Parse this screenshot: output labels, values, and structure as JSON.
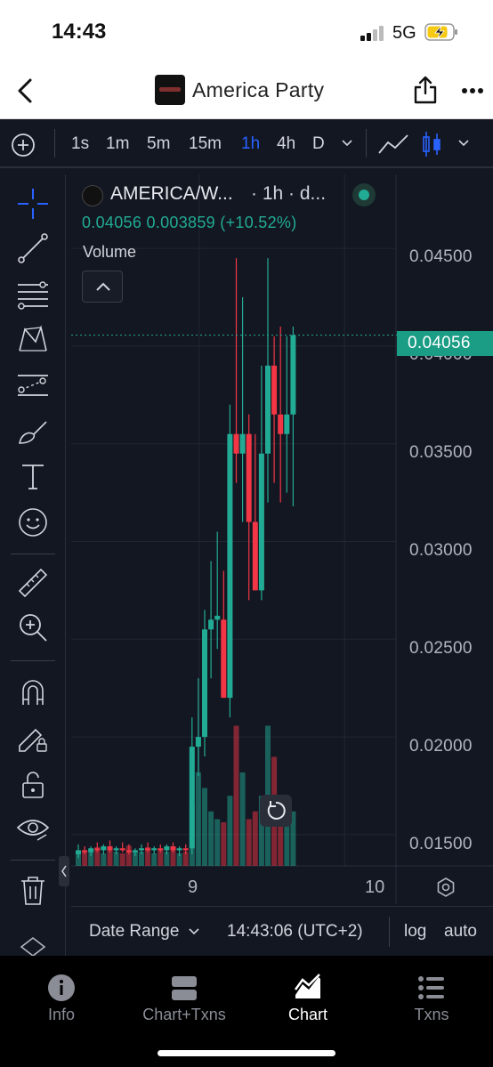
{
  "status_bar": {
    "time": "14:43",
    "network": "5G"
  },
  "header": {
    "title": "America Party"
  },
  "toolbar": {
    "timeframes": [
      "1s",
      "1m",
      "5m",
      "15m",
      "1h",
      "4h",
      "D"
    ],
    "active_timeframe": "1h"
  },
  "chart": {
    "symbol": "AMERICA/W...",
    "interval_label": "· 1h · d...",
    "last_price": "0.04056",
    "change": "0.003859",
    "change_pct": "(+10.52%)",
    "volume_label": "Volume",
    "price_ticks": [
      "0.04500",
      "0.04000",
      "0.03500",
      "0.03000",
      "0.02500",
      "0.02000",
      "0.01500"
    ],
    "time_ticks": [
      "9",
      "10"
    ],
    "footer": {
      "date_range_label": "Date Range",
      "clock": "14:43:06 (UTC+2)",
      "log_label": "log",
      "auto_label": "auto"
    }
  },
  "colors": {
    "up": "#22ab94",
    "down": "#f23645",
    "accent": "#2962ff",
    "background": "#131722"
  },
  "chart_data": {
    "type": "candlestick",
    "interval": "1h",
    "ylim": [
      0.0134,
      0.0471
    ],
    "price_tick_values": [
      0.045,
      0.04,
      0.035,
      0.03,
      0.025,
      0.02,
      0.015
    ],
    "last_price": 0.04056,
    "candles": [
      {
        "o": 0.014,
        "h": 0.0145,
        "l": 0.0138,
        "c": 0.0142
      },
      {
        "o": 0.0142,
        "h": 0.0144,
        "l": 0.014,
        "c": 0.0141
      },
      {
        "o": 0.0141,
        "h": 0.0144,
        "l": 0.0139,
        "c": 0.0143
      },
      {
        "o": 0.0143,
        "h": 0.0146,
        "l": 0.0141,
        "c": 0.0142
      },
      {
        "o": 0.0142,
        "h": 0.0145,
        "l": 0.014,
        "c": 0.0144
      },
      {
        "o": 0.0144,
        "h": 0.0147,
        "l": 0.0141,
        "c": 0.0142
      },
      {
        "o": 0.0142,
        "h": 0.0144,
        "l": 0.014,
        "c": 0.0143
      },
      {
        "o": 0.0143,
        "h": 0.0146,
        "l": 0.0141,
        "c": 0.0142
      },
      {
        "o": 0.0142,
        "h": 0.0145,
        "l": 0.014,
        "c": 0.0141
      },
      {
        "o": 0.0141,
        "h": 0.0143,
        "l": 0.0139,
        "c": 0.0142
      },
      {
        "o": 0.0142,
        "h": 0.0145,
        "l": 0.014,
        "c": 0.0143
      },
      {
        "o": 0.0143,
        "h": 0.0146,
        "l": 0.0141,
        "c": 0.0142
      },
      {
        "o": 0.0142,
        "h": 0.0144,
        "l": 0.014,
        "c": 0.0143
      },
      {
        "o": 0.0143,
        "h": 0.0145,
        "l": 0.0141,
        "c": 0.0142
      },
      {
        "o": 0.0142,
        "h": 0.0145,
        "l": 0.014,
        "c": 0.0144
      },
      {
        "o": 0.0144,
        "h": 0.0146,
        "l": 0.0141,
        "c": 0.0142
      },
      {
        "o": 0.0142,
        "h": 0.0144,
        "l": 0.0139,
        "c": 0.0143
      },
      {
        "o": 0.0143,
        "h": 0.0145,
        "l": 0.014,
        "c": 0.0142
      },
      {
        "o": 0.0143,
        "h": 0.021,
        "l": 0.014,
        "c": 0.0195
      },
      {
        "o": 0.0195,
        "h": 0.023,
        "l": 0.018,
        "c": 0.02
      },
      {
        "o": 0.02,
        "h": 0.0265,
        "l": 0.019,
        "c": 0.0255
      },
      {
        "o": 0.0255,
        "h": 0.029,
        "l": 0.023,
        "c": 0.026
      },
      {
        "o": 0.026,
        "h": 0.0305,
        "l": 0.0245,
        "c": 0.0262
      },
      {
        "o": 0.026,
        "h": 0.0285,
        "l": 0.023,
        "c": 0.022
      },
      {
        "o": 0.022,
        "h": 0.037,
        "l": 0.021,
        "c": 0.0355
      },
      {
        "o": 0.0355,
        "h": 0.0445,
        "l": 0.033,
        "c": 0.0345
      },
      {
        "o": 0.0345,
        "h": 0.0425,
        "l": 0.031,
        "c": 0.0355
      },
      {
        "o": 0.0355,
        "h": 0.0365,
        "l": 0.027,
        "c": 0.031
      },
      {
        "o": 0.031,
        "h": 0.0355,
        "l": 0.0275,
        "c": 0.0275
      },
      {
        "o": 0.0275,
        "h": 0.039,
        "l": 0.027,
        "c": 0.0345
      },
      {
        "o": 0.0345,
        "h": 0.0445,
        "l": 0.032,
        "c": 0.039
      },
      {
        "o": 0.039,
        "h": 0.0405,
        "l": 0.033,
        "c": 0.0365
      },
      {
        "o": 0.0365,
        "h": 0.041,
        "l": 0.032,
        "c": 0.0355
      },
      {
        "o": 0.0355,
        "h": 0.0405,
        "l": 0.0325,
        "c": 0.0365
      },
      {
        "o": 0.0365,
        "h": 0.041,
        "l": 0.0318,
        "c": 0.04056
      }
    ],
    "volume": [
      0.08,
      0.1,
      0.09,
      0.12,
      0.08,
      0.1,
      0.09,
      0.08,
      0.13,
      0.1,
      0.09,
      0.12,
      0.08,
      0.1,
      0.09,
      0.11,
      0.08,
      0.09,
      0.4,
      0.6,
      0.5,
      0.35,
      0.3,
      0.28,
      0.45,
      0.9,
      0.6,
      0.3,
      0.35,
      0.45,
      0.9,
      0.7,
      0.45,
      0.4,
      0.35
    ],
    "xticks": [
      {
        "label": "9",
        "index": 19
      },
      {
        "label": "10",
        "index": 42
      }
    ]
  }
}
